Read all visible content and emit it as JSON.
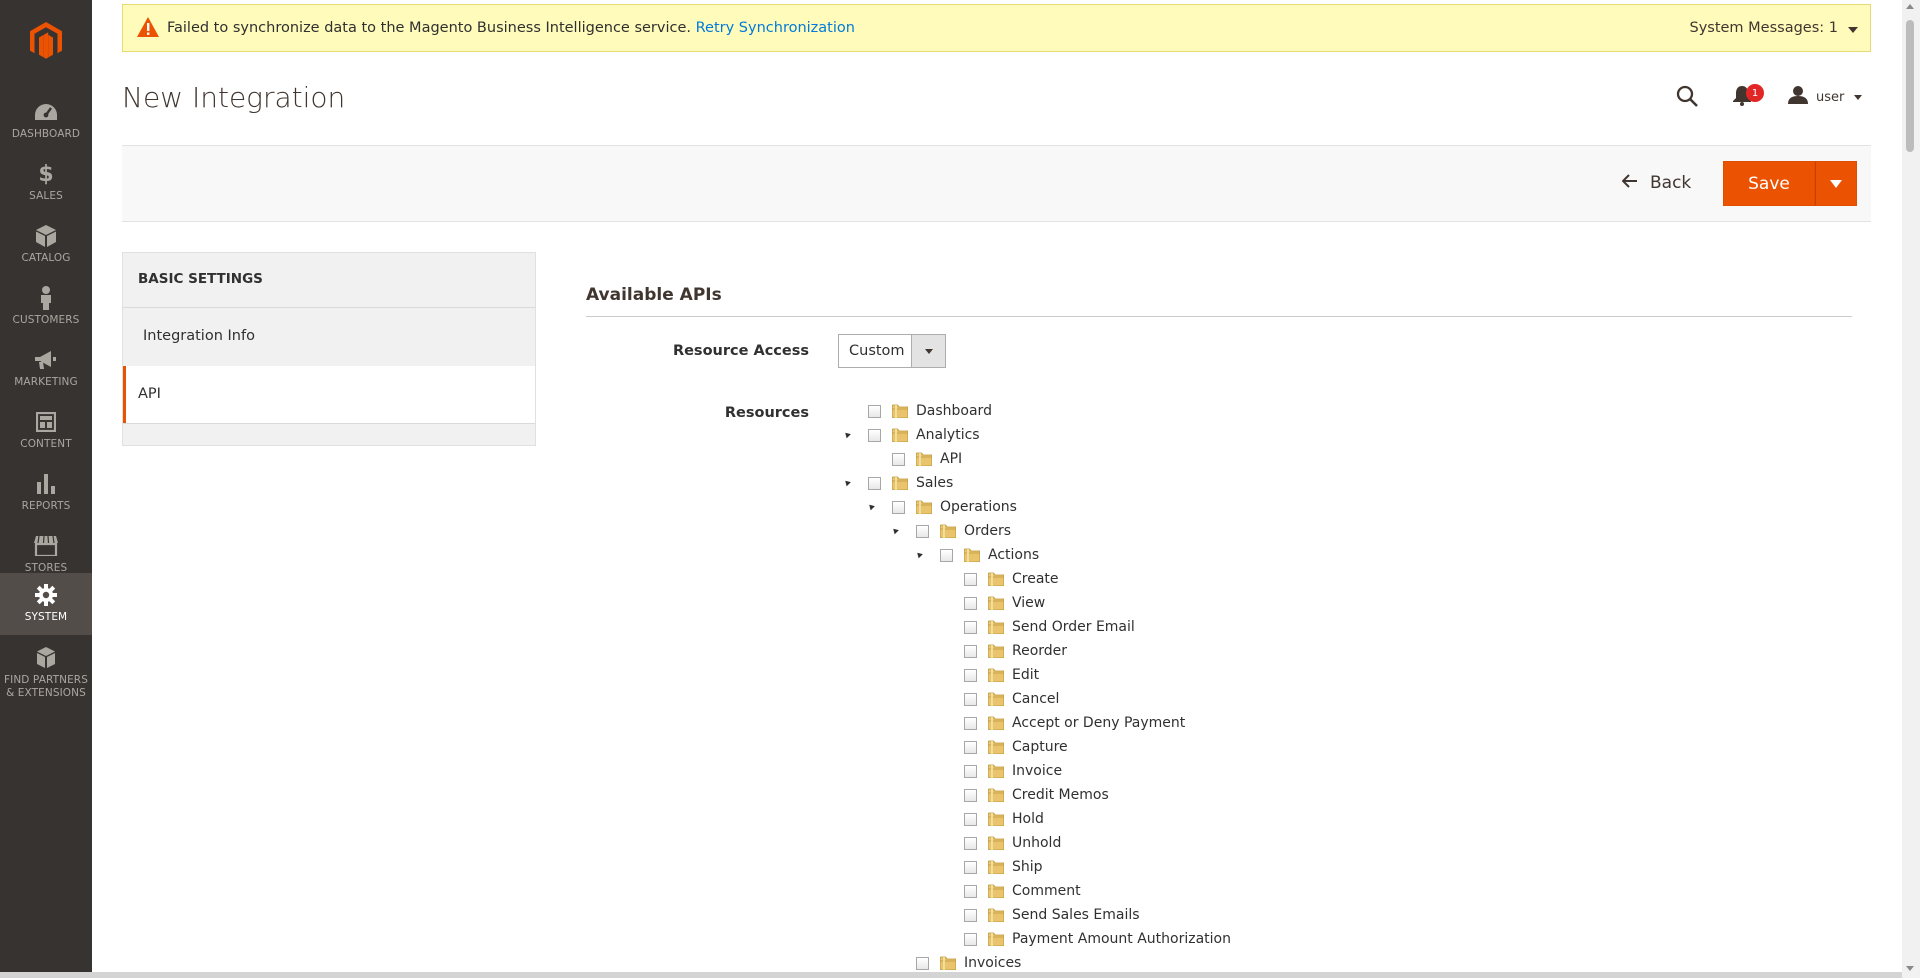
{
  "nav": {
    "items": [
      {
        "label": "DASHBOARD",
        "icon": "dashboard-icon"
      },
      {
        "label": "SALES",
        "icon": "dollar-icon"
      },
      {
        "label": "CATALOG",
        "icon": "box-icon"
      },
      {
        "label": "CUSTOMERS",
        "icon": "person-icon"
      },
      {
        "label": "MARKETING",
        "icon": "megaphone-icon"
      },
      {
        "label": "CONTENT",
        "icon": "layout-icon"
      },
      {
        "label": "REPORTS",
        "icon": "bar-chart-icon"
      },
      {
        "label": "STORES",
        "icon": "store-icon"
      },
      {
        "label": "SYSTEM",
        "icon": "gear-icon"
      },
      {
        "label_line1": "FIND PARTNERS",
        "label_line2": "& EXTENSIONS",
        "icon": "cubes-icon"
      }
    ]
  },
  "system_message": {
    "text": "Failed to synchronize data to the Magento Business Intelligence service.",
    "link": "Retry Synchronization",
    "count": "System Messages: 1"
  },
  "page": {
    "title": "New Integration"
  },
  "header": {
    "notification_count": "1",
    "user": "user"
  },
  "actions": {
    "back": "Back",
    "save": "Save"
  },
  "side": {
    "title": "BASIC SETTINGS",
    "tabs": [
      "Integration Info",
      "API"
    ]
  },
  "api": {
    "section_title": "Available APIs",
    "resource_access_label": "Resource Access",
    "resource_access_value": "Custom",
    "resources_label": "Resources",
    "tree": [
      {
        "label": "Dashboard",
        "level": 0,
        "expanded": false
      },
      {
        "label": "Analytics",
        "level": 0,
        "expanded": true
      },
      {
        "label": "API",
        "level": 1,
        "expanded": false
      },
      {
        "label": "Sales",
        "level": 0,
        "expanded": true
      },
      {
        "label": "Operations",
        "level": 1,
        "expanded": true
      },
      {
        "label": "Orders",
        "level": 2,
        "expanded": true
      },
      {
        "label": "Actions",
        "level": 3,
        "expanded": true
      },
      {
        "label": "Create",
        "level": 4,
        "expanded": false
      },
      {
        "label": "View",
        "level": 4,
        "expanded": false
      },
      {
        "label": "Send Order Email",
        "level": 4,
        "expanded": false
      },
      {
        "label": "Reorder",
        "level": 4,
        "expanded": false
      },
      {
        "label": "Edit",
        "level": 4,
        "expanded": false
      },
      {
        "label": "Cancel",
        "level": 4,
        "expanded": false
      },
      {
        "label": "Accept or Deny Payment",
        "level": 4,
        "expanded": false
      },
      {
        "label": "Capture",
        "level": 4,
        "expanded": false
      },
      {
        "label": "Invoice",
        "level": 4,
        "expanded": false
      },
      {
        "label": "Credit Memos",
        "level": 4,
        "expanded": false
      },
      {
        "label": "Hold",
        "level": 4,
        "expanded": false
      },
      {
        "label": "Unhold",
        "level": 4,
        "expanded": false
      },
      {
        "label": "Ship",
        "level": 4,
        "expanded": false
      },
      {
        "label": "Comment",
        "level": 4,
        "expanded": false
      },
      {
        "label": "Send Sales Emails",
        "level": 4,
        "expanded": false
      },
      {
        "label": "Payment Amount Authorization",
        "level": 4,
        "expanded": false
      },
      {
        "label": "Invoices",
        "level": 2,
        "expanded": false
      }
    ]
  },
  "colors": {
    "nav_bg": "#373330",
    "accent": "#eb5202",
    "link": "#007bdb",
    "message_bg": "#fffbbb"
  }
}
